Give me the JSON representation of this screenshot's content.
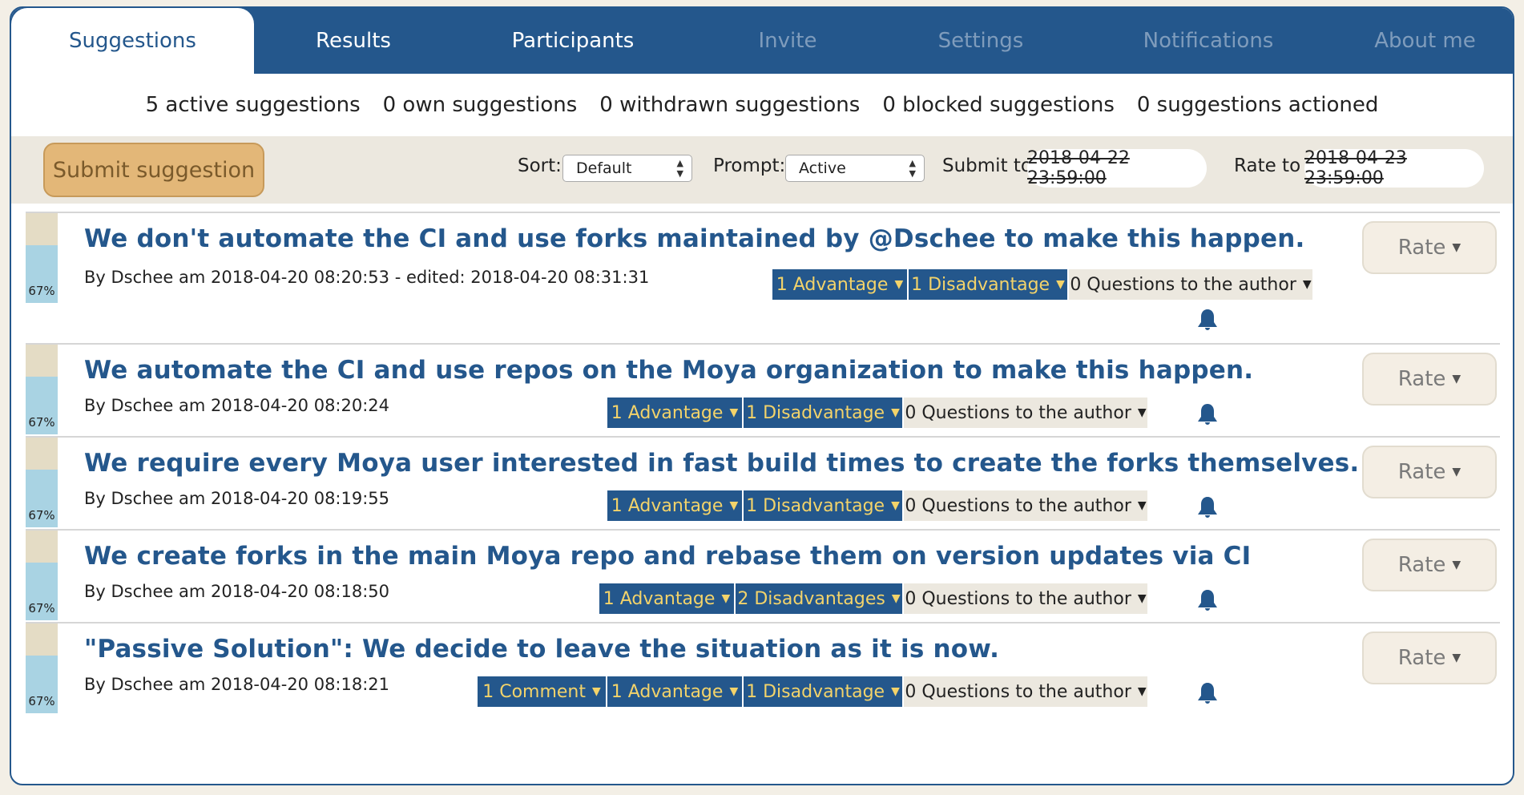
{
  "tabs": {
    "suggestions": "Suggestions",
    "results": "Results",
    "participants": "Participants",
    "invite": "Invite",
    "settings": "Settings",
    "notifications": "Notifications",
    "about": "About me"
  },
  "stats": {
    "active": "5 active suggestions",
    "own": "0 own suggestions",
    "withdrawn": "0 withdrawn suggestions",
    "blocked": "0 blocked suggestions",
    "actioned": "0 suggestions actioned"
  },
  "toolbar": {
    "submit_label": "Submit suggestion",
    "sort_label": "Sort:",
    "sort_value": "Default",
    "prompt_label": "Prompt:",
    "prompt_value": "Active",
    "submit_to_label": "Submit to",
    "submit_to_date": "2018-04-22 23:59:00",
    "rate_to_label": "Rate to",
    "rate_to_date": "2018-04-23 23:59:00"
  },
  "rate_label": "Rate",
  "suggestions": [
    {
      "title": "We don't automate the CI and use forks maintained by @Dschee to make this happen.",
      "meta": "By Dschee am 2018-04-20 08:20:53 - edited: 2018-04-20 08:31:31",
      "percent": "67%",
      "advantages": "1 Advantage",
      "disadvantages": "1 Disadvantage",
      "questions": "0 Questions to the author"
    },
    {
      "title": "We automate the CI and use repos on the Moya organization to make this happen.",
      "meta": "By Dschee am 2018-04-20 08:20:24",
      "percent": "67%",
      "advantages": "1 Advantage",
      "disadvantages": "1 Disadvantage",
      "questions": "0 Questions to the author"
    },
    {
      "title": "We require every Moya user interested in fast build times to create the forks themselves.",
      "meta": "By Dschee am 2018-04-20 08:19:55",
      "percent": "67%",
      "advantages": "1 Advantage",
      "disadvantages": "1 Disadvantage",
      "questions": "0 Questions to the author"
    },
    {
      "title": "We create forks in the main Moya repo and rebase them on version updates via CI",
      "meta": "By Dschee am 2018-04-20 08:18:50",
      "percent": "67%",
      "advantages": "1 Advantage",
      "disadvantages": "2 Disadvantages",
      "questions": "0 Questions to the author"
    },
    {
      "title": "\"Passive Solution\": We decide to leave the situation as it is now.",
      "meta": "By Dschee am 2018-04-20 08:18:21",
      "percent": "67%",
      "comments": "1 Comment",
      "advantages": "1 Advantage",
      "disadvantages": "1 Disadvantage",
      "questions": "0 Questions to the author"
    }
  ],
  "colors": {
    "primary": "#24578c",
    "accent_text": "#f3d36a",
    "submit_button": "#e3b778",
    "percent_bar": "#a9d3e3",
    "percent_bar_top": "#e4dcc5",
    "toolbar_bg": "#ece8df"
  },
  "icons": {
    "bell": "bell-icon"
  }
}
